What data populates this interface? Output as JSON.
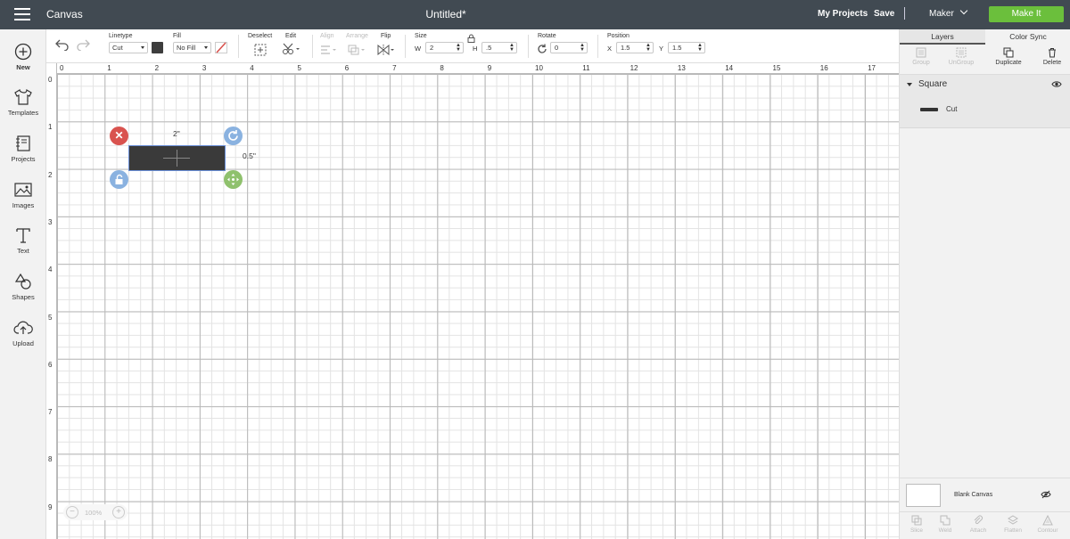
{
  "topbar": {
    "app_title": "Canvas",
    "doc_title": "Untitled*",
    "my_projects": "My Projects",
    "save": "Save",
    "separator": "|",
    "machine": "Maker",
    "make_it": "Make It"
  },
  "sidebar": {
    "items": [
      {
        "label": "New",
        "icon": "plus-circle-icon"
      },
      {
        "label": "Templates",
        "icon": "tshirt-icon"
      },
      {
        "label": "Projects",
        "icon": "notebook-icon"
      },
      {
        "label": "Images",
        "icon": "image-icon"
      },
      {
        "label": "Text",
        "icon": "text-t-icon"
      },
      {
        "label": "Shapes",
        "icon": "shapes-icon"
      },
      {
        "label": "Upload",
        "icon": "cloud-upload-icon"
      }
    ]
  },
  "toolbar": {
    "linetype_label": "Linetype",
    "linetype_value": "Cut",
    "fill_label": "Fill",
    "fill_value": "No Fill",
    "deselect_label": "Deselect",
    "edit_label": "Edit",
    "align_label": "Align",
    "arrange_label": "Arrange",
    "flip_label": "Flip",
    "size_label": "Size",
    "w_label": "W",
    "w_value": "2",
    "h_label": "H",
    "h_value": ".5",
    "rotate_label": "Rotate",
    "rotate_value": "0",
    "position_label": "Position",
    "x_label": "X",
    "x_value": "1.5",
    "y_label": "Y",
    "y_value": "1.5",
    "linetype_color": "#3d3d3d"
  },
  "canvas": {
    "ruler_x": [
      "0",
      "1",
      "2",
      "3",
      "4",
      "5",
      "6",
      "7",
      "8",
      "9",
      "10",
      "11",
      "12",
      "13",
      "14",
      "15",
      "16",
      "17"
    ],
    "ruler_y": [
      "0",
      "1",
      "2",
      "3",
      "4",
      "5",
      "6",
      "7",
      "8",
      "9"
    ],
    "width_dim": "2\"",
    "height_dim": "0.5\"",
    "zoom": "100%",
    "zoom_minus": "−",
    "zoom_plus": "+"
  },
  "right_panel": {
    "tabs": [
      "Layers",
      "Color Sync"
    ],
    "layer_tools": [
      "Group",
      "UnGroup",
      "Duplicate",
      "Delete"
    ],
    "layer_name": "Square",
    "layer_child": "Cut",
    "blank_canvas": "Blank Canvas",
    "bottom_tools": [
      "Slice",
      "Weld",
      "Attach",
      "Flatten",
      "Contour"
    ]
  }
}
